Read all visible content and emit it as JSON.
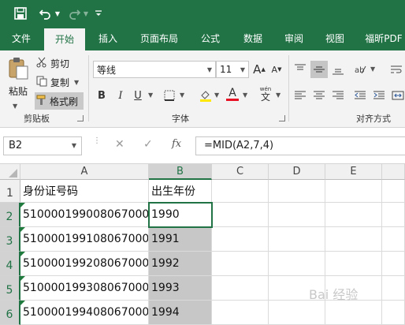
{
  "tabs": [
    "文件",
    "开始",
    "插入",
    "页面布局",
    "公式",
    "数据",
    "审阅",
    "视图",
    "福昕PDF"
  ],
  "clipboard": {
    "paste_label": "粘贴",
    "cut_label": "剪切",
    "copy_label": "复制",
    "format_painter_label": "格式刷",
    "group_label": "剪贴板"
  },
  "font": {
    "font_name": "等线",
    "font_size": "11",
    "group_label": "字体",
    "bold": "B",
    "italic": "I",
    "underline": "U",
    "font_color_glyph": "A",
    "increase_font": "A",
    "decrease_font": "A",
    "phonetic_top": "wén",
    "phonetic_glyph": "文"
  },
  "alignment": {
    "group_label": "对齐方式"
  },
  "formula_bar": {
    "name_box": "B2",
    "cancel_glyph": "✕",
    "enter_glyph": "✓",
    "fx_label": "fx",
    "formula": "=MID(A2,7,4)"
  },
  "columns": [
    "A",
    "B",
    "C",
    "D",
    "E"
  ],
  "rows": [
    {
      "num": "1",
      "a": "身份证号码",
      "b": "出生年份"
    },
    {
      "num": "2",
      "a": "510000199008067000",
      "b": "1990"
    },
    {
      "num": "3",
      "a": "510000199108067000",
      "b": "1991"
    },
    {
      "num": "4",
      "a": "510000199208067000",
      "b": "1992"
    },
    {
      "num": "5",
      "a": "510000199308067000",
      "b": "1993"
    },
    {
      "num": "6",
      "a": "510000199408067000",
      "b": "1994"
    }
  ],
  "selected_cell": "B2",
  "colors": {
    "accent": "#217346",
    "selection_fill": "#c7c7c7",
    "error_triangle": "#1e7b3c"
  },
  "watermark": "Bai 经验"
}
